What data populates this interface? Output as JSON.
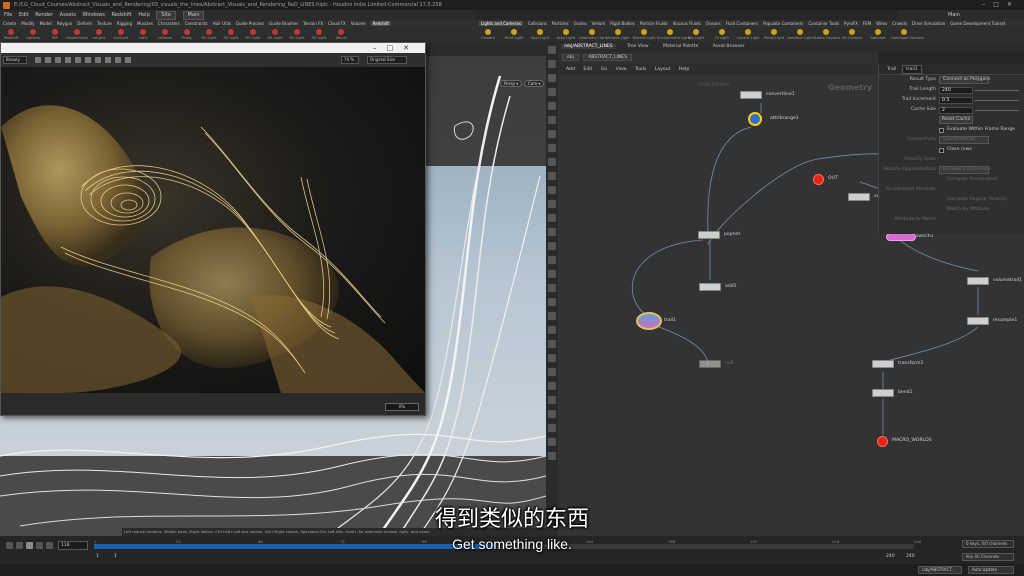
{
  "app": {
    "title": "E:/CG_Cloud_Courses/Abstract_Visuals_and_Rendering/03_visuals_the_lines/Abstract_Visuals_and_Rendering_ReD_LINES.hiplc - Houdini Indie Limited-Commercial 17.5.258",
    "menu": [
      "File",
      "Edit",
      "Render",
      "Assets",
      "Windows",
      "Redshift",
      "Help"
    ],
    "desk_left": "Site",
    "desk_right": "Main",
    "desk_top_right": "Main"
  },
  "shelf_left": {
    "tabs": [
      "Create",
      "Modify",
      "Model",
      "Polygon",
      "Deform",
      "Texture",
      "Rigging",
      "Muscles",
      "Characters",
      "Constraints",
      "Hair Utils",
      "Guide Process",
      "Guide Brushes",
      "Terrain FX",
      "Cloud FX",
      "Volume",
      "Redshift"
    ],
    "active_tab": "Redshift",
    "tools": [
      "Redshift",
      "Options",
      "IPR",
      "RenderView",
      "rsLight",
      "Sunlight",
      "rsIES",
      "rsDome",
      "Proxy",
      "RS Light",
      "RS Light",
      "RS Light",
      "RS Light",
      "RS Light",
      "RS Light",
      "About"
    ]
  },
  "shelf_right": {
    "tabs": [
      "Lights and Cameras",
      "Collisions",
      "Particles",
      "Grains",
      "Vellum",
      "Rigid Bodies",
      "Particle Fluids",
      "Viscous Fluids",
      "Oceans",
      "Fluid Containers",
      "Populate Containers",
      "Container Tools",
      "PyroFX",
      "FEM",
      "Wires",
      "Crowds",
      "Drive Simulation",
      "Game Development Toolset"
    ],
    "active_tab": "Lights and Cameras",
    "tools": [
      "Camera",
      "Point Light",
      "Spot Light",
      "Area Light",
      "Geometry Light",
      "Volume Light",
      "Distant Light",
      "Environment Light",
      "Sky Light",
      "GI Light",
      "Caustic Light",
      "Portal Light",
      "Ambient Light",
      "Stereo Camera",
      "VR Camera",
      "Switcher",
      "Gamepad Camera"
    ]
  },
  "scene_viewer": {
    "persp": "Persp ▾",
    "cam": "Cam ▾",
    "status_hint": "Left mouse tumbles. Middle pans. Right dollies. Ctrl+Alt+Left box zooms. Ctrl+Right zooms. Spacebar-Ctrl-Left tilts. Hold L for alternate tumble, dolly, and zoom."
  },
  "render_window": {
    "frame_field": "Beauty",
    "zoom": "74 %",
    "size_mode": "Original Size",
    "progress": "0%"
  },
  "network": {
    "pane_tabs": [
      "/obj/ABSTRACT_LINES",
      "Tree View",
      "Material Palette",
      "Asset Browser"
    ],
    "active_pane_tab": "/obj/ABSTRACT_LINES",
    "path": [
      "obj",
      "ABSTRACT_LINES"
    ],
    "menu": [
      "Add",
      "Edit",
      "Go",
      "View",
      "Tools",
      "Layout",
      "Help"
    ],
    "context_label": "Geometry",
    "bg_label": "Indie Edition",
    "nodes": {
      "convertline1": "convertline1",
      "attribrange1": "attribrange1",
      "out": "OUT",
      "volume_partial": "volu",
      "popnet": "popnet",
      "add1": "add1",
      "switch1": "switch1",
      "trail1": "trail1",
      "null_partial": "null",
      "volumetrail1": "volumetrail1",
      "resample1": "resample1",
      "transform1": "transform1",
      "bend1": "bend1",
      "macro_worlds": "MACRO_WORLDS"
    }
  },
  "parameters": {
    "node_type": "Trail",
    "node_name": "trail1",
    "rows": {
      "result_type_label": "Result Type",
      "result_type_value": "Connect as Polygons",
      "trail_length_label": "Trail Length",
      "trail_length_value": "240",
      "trail_increment_label": "Trail Increment",
      "trail_increment_value": "0.5",
      "cache_size_label": "Cache Size",
      "cache_size_value": "2",
      "reset_cache": "Reset Cache",
      "evaluate_label": "Evaluate Within Frame Range",
      "connectivity_label": "Connectivity",
      "connectivity_value": "Quadrilaterals",
      "close_rows": "Close rows",
      "velocity_scale_label": "Velocity Scale",
      "velocity_approx_label": "Velocity Approximation",
      "velocity_approx_value": "Backward Difference",
      "compute_accel": "Compute Acceleration",
      "accel_attr_label": "Acceleration Attribute",
      "compute_angular": "Compute Angular Velocity",
      "match_by_attr": "Match by Attribute",
      "attr_to_match_label": "Attribute to Match"
    }
  },
  "timeline": {
    "current_frame": "118",
    "tick_labels": [
      "1",
      "24",
      "48",
      "72",
      "96",
      "120",
      "144",
      "168",
      "192",
      "216",
      "240"
    ],
    "start_frame": "1",
    "start_frame2": "1",
    "end_frame": "240",
    "end_frame2": "240",
    "keys_label": "0 keys, 0/0 channels",
    "key_all": "Key All Channels",
    "obj_path": "/obj/ABSTRACT...",
    "auto_update": "Auto Update",
    "progress_fraction": 0.49
  },
  "subtitle": {
    "zh": "得到类似的东西",
    "en": "Get something like."
  },
  "colors": {
    "accent_blue": "#1b5fb0",
    "out_node": "#e8231a",
    "switch_node": "#d86bd0",
    "render_gold": "#c9a24a"
  }
}
